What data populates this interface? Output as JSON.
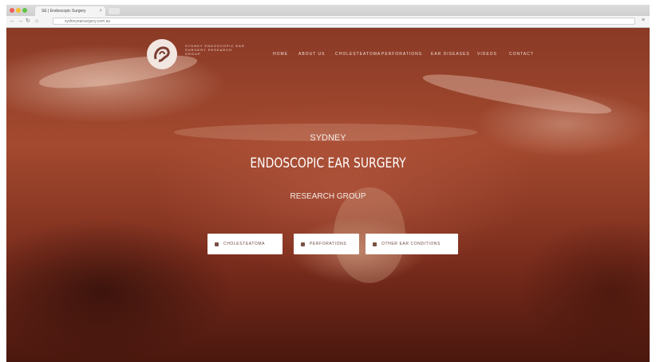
{
  "browser": {
    "tab_title": "SE | Endoscopic Surgery",
    "url": "sydneyearsurgery.com.au",
    "traffic_lights": [
      "#ee5e57",
      "#f6bd2f",
      "#5fc441"
    ]
  },
  "site": {
    "logo_text": "SYDNEY ENDOSCOPIC EAR SURGERY RESEARCH GROUP",
    "nav": [
      "HOME",
      "ABOUT US",
      "CHOLESTEATOMA",
      "PERFORATIONS",
      "EAR DISEASES",
      "VIDEOS",
      "CONTACT"
    ]
  },
  "hero": {
    "line1": "SYDNEY",
    "title": "ENDOSCOPIC EAR SURGERY",
    "line3": "RESEARCH GROUP"
  },
  "buttons": {
    "cholesteatoma": "CHOLESTEATOMA",
    "perforations": "PERFORATIONS",
    "other": "OTHER EAR CONDITIONS"
  }
}
